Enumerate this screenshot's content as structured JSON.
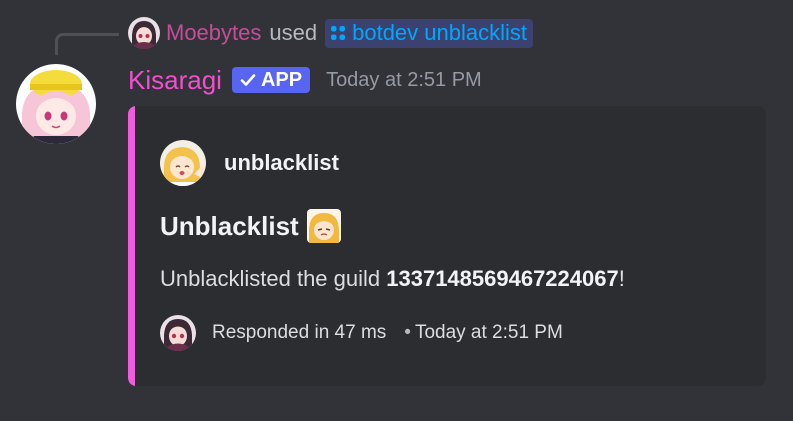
{
  "command_usage": {
    "user": "Moebytes",
    "verb": "used",
    "command": "botdev unblacklist",
    "user_color": "#c54d9a",
    "command_color": "#00a8fc"
  },
  "message": {
    "author": "Kisaragi",
    "author_color": "#f04fce",
    "badge": "APP",
    "badge_color": "#5865f2",
    "timestamp": "Today at 2:51 PM"
  },
  "embed": {
    "accent_color": "#ee5dde",
    "author_name": "unblacklist",
    "title": "Unblacklist",
    "description_prefix": "Unblacklisted the guild ",
    "guild_id": "1337148569467224067",
    "description_suffix": "!",
    "footer_response": "Responded in 47 ms",
    "footer_separator": "•",
    "footer_time": "Today at 2:51 PM"
  },
  "icons": {
    "command": "slash-command-icon",
    "verified": "checkmark-icon"
  }
}
